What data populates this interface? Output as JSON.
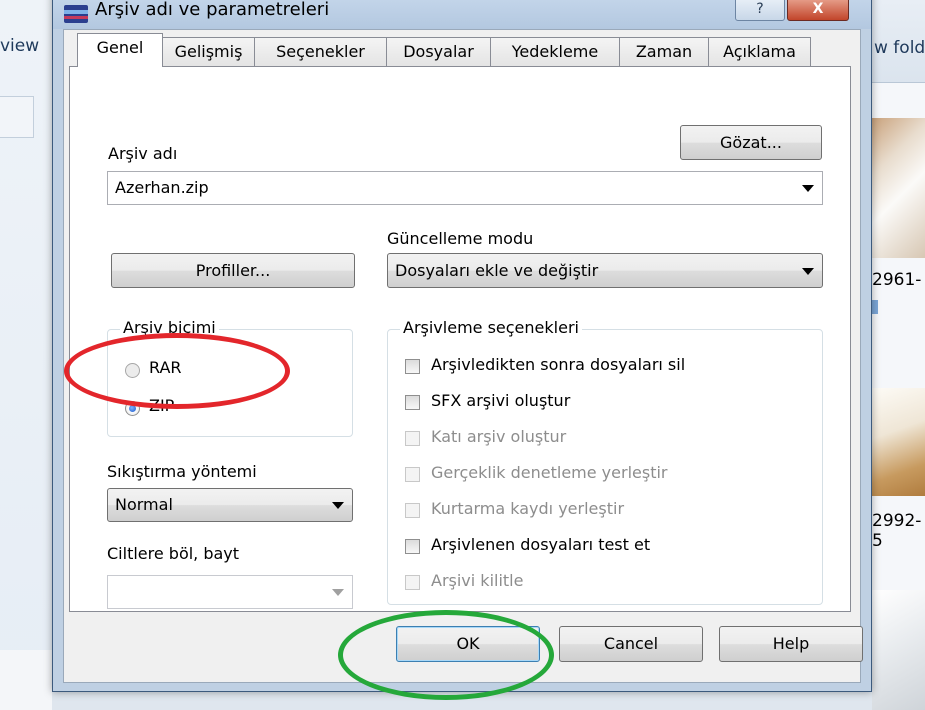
{
  "background": {
    "left_toolbar_text": "view",
    "right_toolbar_text": "w fold",
    "thumb_labels": [
      "2961-",
      "2992-",
      "5"
    ]
  },
  "dialog": {
    "title": "Arşiv adı ve parametreleri",
    "help_btn": "?",
    "close_btn": "X"
  },
  "tabs": [
    "Genel",
    "Gelişmiş",
    "Seçenekler",
    "Dosyalar",
    "Yedekleme",
    "Zaman",
    "Açıklama"
  ],
  "general": {
    "archive_name_label": "Arşiv adı",
    "browse_button": "Gözat...",
    "archive_name_value": "Azerhan.zip",
    "update_mode_label": "Güncelleme modu",
    "update_mode_value": "Dosyaları ekle ve değiştir",
    "profiles_button": "Profiller...",
    "archive_format_title": "Arşiv biçimi",
    "format_options": [
      {
        "label": "RAR",
        "selected": false
      },
      {
        "label": "ZIP",
        "selected": true
      }
    ],
    "compression_label": "Sıkıştırma yöntemi",
    "compression_value": "Normal",
    "split_label": "Ciltlere böl, bayt",
    "split_value": "",
    "archiving_options_title": "Arşivleme seçenekleri",
    "archiving_options": [
      {
        "label": "Arşivledikten sonra dosyaları sil",
        "enabled": true,
        "checked": false
      },
      {
        "label": "SFX arşivi oluştur",
        "enabled": true,
        "checked": false
      },
      {
        "label": "Katı arşiv oluştur",
        "enabled": false,
        "checked": false
      },
      {
        "label": "Gerçeklik denetleme yerleştir",
        "enabled": false,
        "checked": false
      },
      {
        "label": "Kurtarma kaydı yerleştir",
        "enabled": false,
        "checked": false
      },
      {
        "label": "Arşivlenen dosyaları test et",
        "enabled": true,
        "checked": false
      },
      {
        "label": "Arşivi kilitle",
        "enabled": false,
        "checked": false
      }
    ]
  },
  "footer": {
    "ok": "OK",
    "cancel": "Cancel",
    "help": "Help"
  },
  "annotations": {
    "red_ellipse_color": "#e3262b",
    "green_ellipse_color": "#25a83a"
  }
}
